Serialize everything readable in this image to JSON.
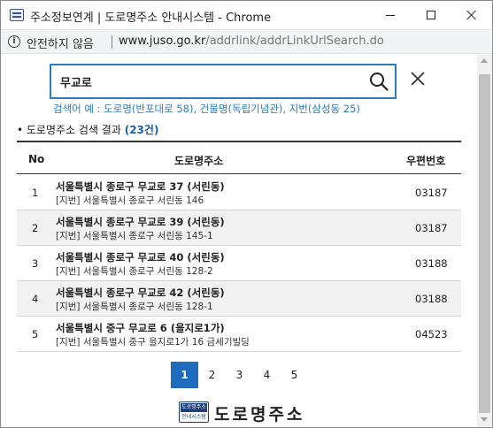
{
  "window": {
    "title": "주소정보연계 | 도로명주소 안내시스템 - Chrome"
  },
  "address_bar": {
    "security_label": "안전하지 않음",
    "url_host": "www.juso.go.kr",
    "url_path": "/addrlink/addrLinkUrlSearch.do"
  },
  "search": {
    "value": "무교로",
    "example": "검색어 예 : 도로명(반포대로 58), 건물명(독립기념관), 지번(삼성동 25)"
  },
  "results": {
    "title_prefix": "• 도로명주소 검색 결과",
    "count": "(23건)",
    "headers": {
      "no": "No",
      "road": "도로명주소",
      "zip": "우편번호"
    },
    "rows": [
      {
        "no": "1",
        "road": "서울특별시 종로구 무교로 37 (서린동)",
        "jibun": "[지번] 서울특별시 종로구 서린동 146",
        "zip": "03187"
      },
      {
        "no": "2",
        "road": "서울특별시 종로구 무교로 39 (서린동)",
        "jibun": "[지번] 서울특별시 종로구 서린동 145-1",
        "zip": "03187"
      },
      {
        "no": "3",
        "road": "서울특별시 종로구 무교로 40 (서린동)",
        "jibun": "[지번] 서울특별시 종로구 서린동 128-2",
        "zip": "03188"
      },
      {
        "no": "4",
        "road": "서울특별시 종로구 무교로 42 (서린동)",
        "jibun": "[지번] 서울특별시 종로구 서린동 128-1",
        "zip": "03188"
      },
      {
        "no": "5",
        "road": "서울특별시 중구 무교로 6 (을지로1가)",
        "jibun": "[지번] 서울특별시 중구 을지로1가 16 금세기빌딩",
        "zip": "04523"
      }
    ]
  },
  "pagination": {
    "pages": [
      "1",
      "2",
      "3",
      "4",
      "5"
    ],
    "active": "1"
  },
  "brand": {
    "mark_top": "도로명주소",
    "mark_bottom": "안내시스템",
    "text": "도로명주소"
  },
  "colors": {
    "accent": "#2b7bbf",
    "active_page": "#1f6bbd",
    "brand": "#1f3f7a"
  }
}
